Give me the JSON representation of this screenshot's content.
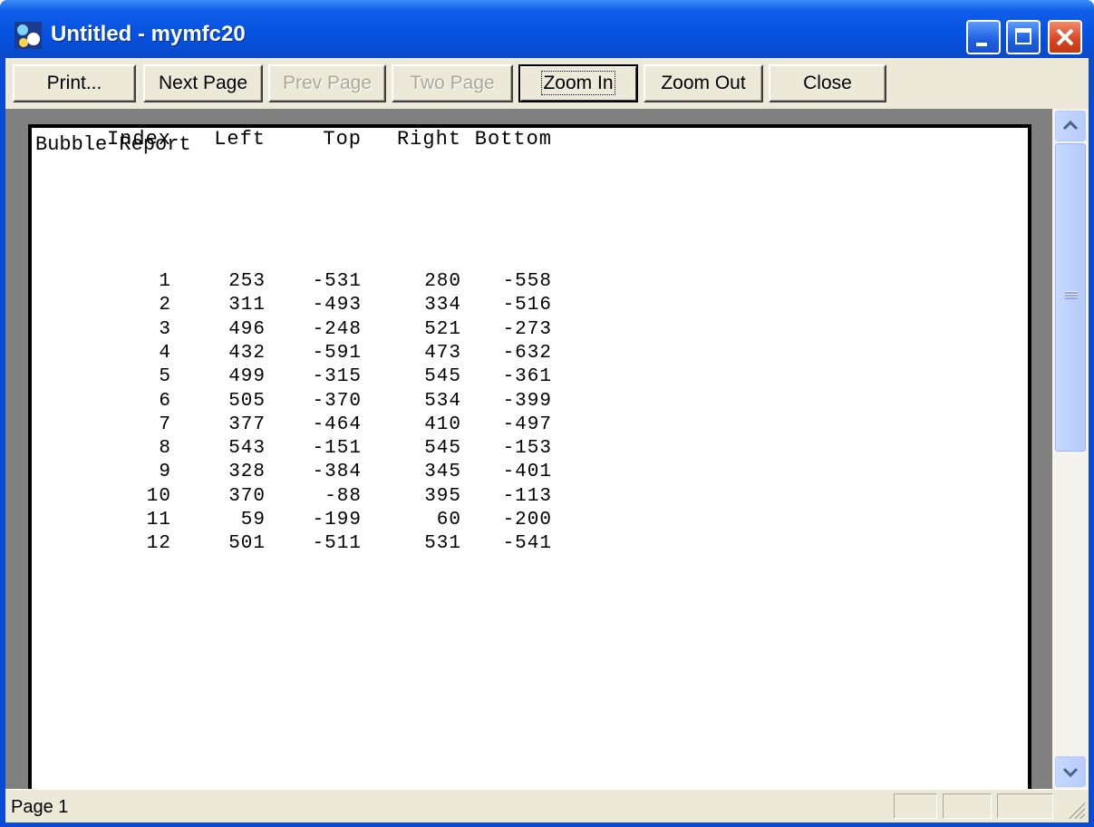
{
  "window": {
    "title": "Untitled - mymfc20",
    "app_icon": "app-icon",
    "controls": {
      "minimize": "minimize-icon",
      "maximize": "maximize-icon",
      "close": "close-icon"
    }
  },
  "toolbar": {
    "buttons": [
      {
        "label": "Print...",
        "enabled": true
      },
      {
        "label": "Next Page",
        "enabled": true
      },
      {
        "label": "Prev Page",
        "enabled": false
      },
      {
        "label": "Two Page",
        "enabled": false
      },
      {
        "label": "Zoom In",
        "enabled": true,
        "focused": true
      },
      {
        "label": "Zoom Out",
        "enabled": true
      },
      {
        "label": "Close",
        "enabled": true
      }
    ]
  },
  "report": {
    "title": "Bubble Report",
    "columns": [
      "Index",
      "Left",
      "Top",
      "Right",
      "Bottom"
    ],
    "rows": [
      [
        "1",
        "253",
        "-531",
        "280",
        "-558"
      ],
      [
        "2",
        "311",
        "-493",
        "334",
        "-516"
      ],
      [
        "3",
        "496",
        "-248",
        "521",
        "-273"
      ],
      [
        "4",
        "432",
        "-591",
        "473",
        "-632"
      ],
      [
        "5",
        "499",
        "-315",
        "545",
        "-361"
      ],
      [
        "6",
        "505",
        "-370",
        "534",
        "-399"
      ],
      [
        "7",
        "377",
        "-464",
        "410",
        "-497"
      ],
      [
        "8",
        "543",
        "-151",
        "545",
        "-153"
      ],
      [
        "9",
        "328",
        "-384",
        "345",
        "-401"
      ],
      [
        "10",
        "370",
        "-88",
        "395",
        "-113"
      ],
      [
        "11",
        "59",
        "-199",
        "60",
        "-200"
      ],
      [
        "12",
        "501",
        "-511",
        "531",
        "-541"
      ]
    ]
  },
  "statusbar": {
    "text": "Page 1"
  },
  "colors": {
    "titlebar": "#0551e0",
    "face": "#ece9d8",
    "close_button": "#d7441f",
    "preview_background": "#808080"
  }
}
